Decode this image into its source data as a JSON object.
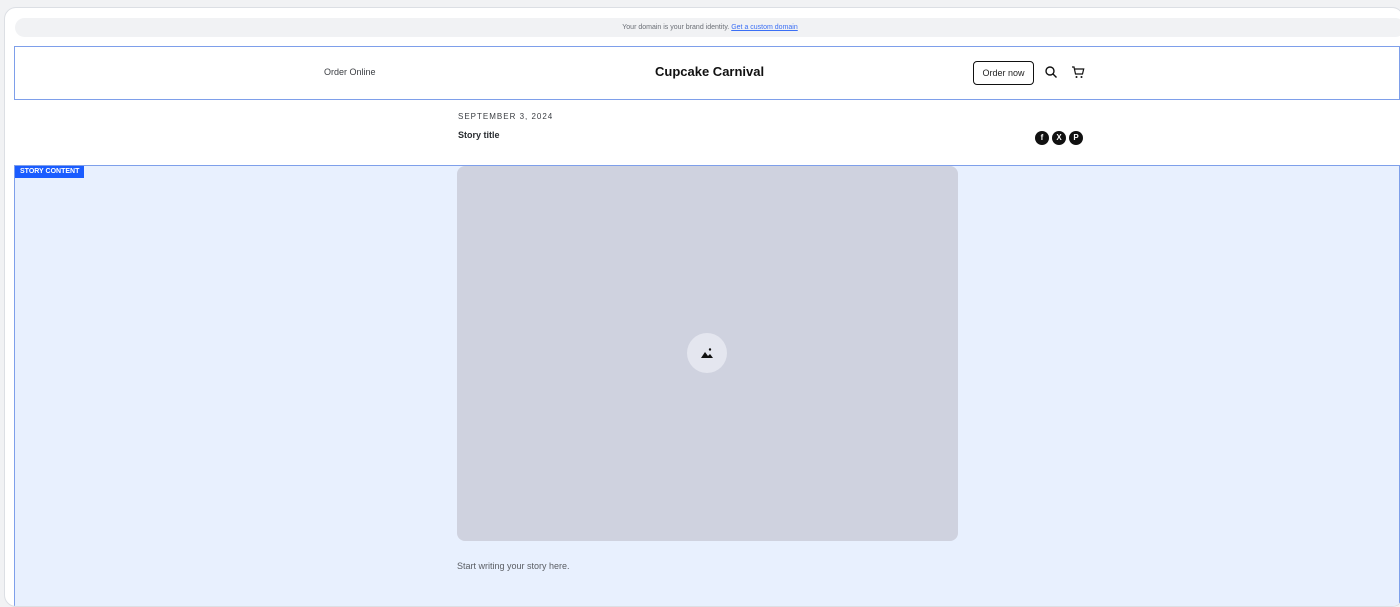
{
  "banner": {
    "message": "Your domain is your brand identity.",
    "link": "Get a custom domain"
  },
  "header": {
    "nav_link": "Order Online",
    "site_title": "Cupcake Carnival",
    "order_button": "Order now",
    "icons": [
      "search-icon",
      "cart-icon"
    ]
  },
  "post": {
    "date": "SEPTEMBER 3, 2024",
    "title": "Story title",
    "share_icons": [
      "facebook-icon",
      "x-icon",
      "pinterest-icon"
    ]
  },
  "content": {
    "tag": "STORY CONTENT",
    "body_placeholder": "Start writing your story here."
  },
  "colors": {
    "accent": "#1a5cff",
    "selection_bg": "#e8f0fe",
    "image_placeholder": "#cfd2df"
  }
}
